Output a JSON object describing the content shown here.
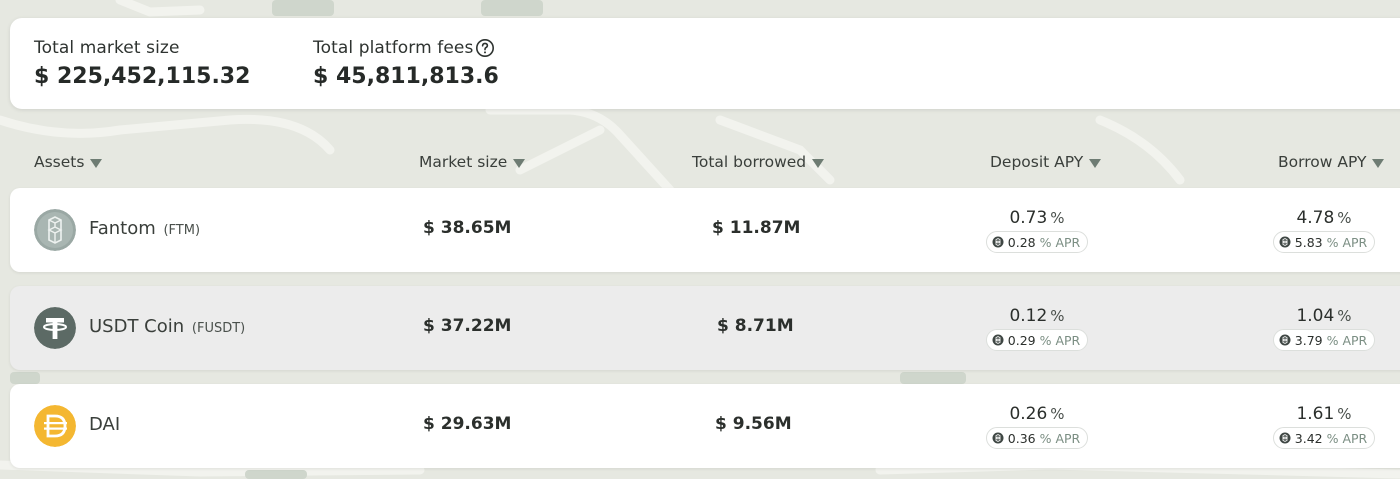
{
  "stats": {
    "total_market_size_label": "Total market size",
    "total_market_size_value": "$ 225,452,115.32",
    "total_platform_fees_label": "Total platform fees",
    "total_platform_fees_value": "$ 45,811,813.6"
  },
  "columns": {
    "assets": "Assets",
    "market_size": "Market size",
    "total_borrowed": "Total borrowed",
    "deposit_apy": "Deposit APY",
    "borrow_apy": "Borrow APY"
  },
  "assets": [
    {
      "name": "Fantom",
      "symbol": "(FTM)",
      "market_size": "$ 38.65M",
      "total_borrowed": "$ 11.87M",
      "deposit_apy": "0.73",
      "deposit_apy_unit": "%",
      "deposit_apr": "0.28",
      "deposit_apr_unit": "% APR",
      "borrow_apy": "4.78",
      "borrow_apy_unit": "%",
      "borrow_apr": "5.83",
      "borrow_apr_unit": "% APR",
      "icon": "fantom-icon",
      "icon_color": "#9aa8a4",
      "selected": false
    },
    {
      "name": "USDT Coin",
      "symbol": "(FUSDT)",
      "market_size": "$ 37.22M",
      "total_borrowed": "$ 8.71M",
      "deposit_apy": "0.12",
      "deposit_apy_unit": "%",
      "deposit_apr": "0.29",
      "deposit_apr_unit": "% APR",
      "borrow_apy": "1.04",
      "borrow_apy_unit": "%",
      "borrow_apr": "3.79",
      "borrow_apr_unit": "% APR",
      "icon": "tether-icon",
      "icon_color": "#5c6a65",
      "selected": true
    },
    {
      "name": "DAI",
      "symbol": "",
      "market_size": "$ 29.63M",
      "total_borrowed": "$ 9.56M",
      "deposit_apy": "0.26",
      "deposit_apy_unit": "%",
      "deposit_apr": "0.36",
      "deposit_apr_unit": "% APR",
      "borrow_apy": "1.61",
      "borrow_apy_unit": "%",
      "borrow_apr": "3.42",
      "borrow_apr_unit": "% APR",
      "icon": "dai-icon",
      "icon_color": "#f4b731",
      "selected": false
    }
  ]
}
